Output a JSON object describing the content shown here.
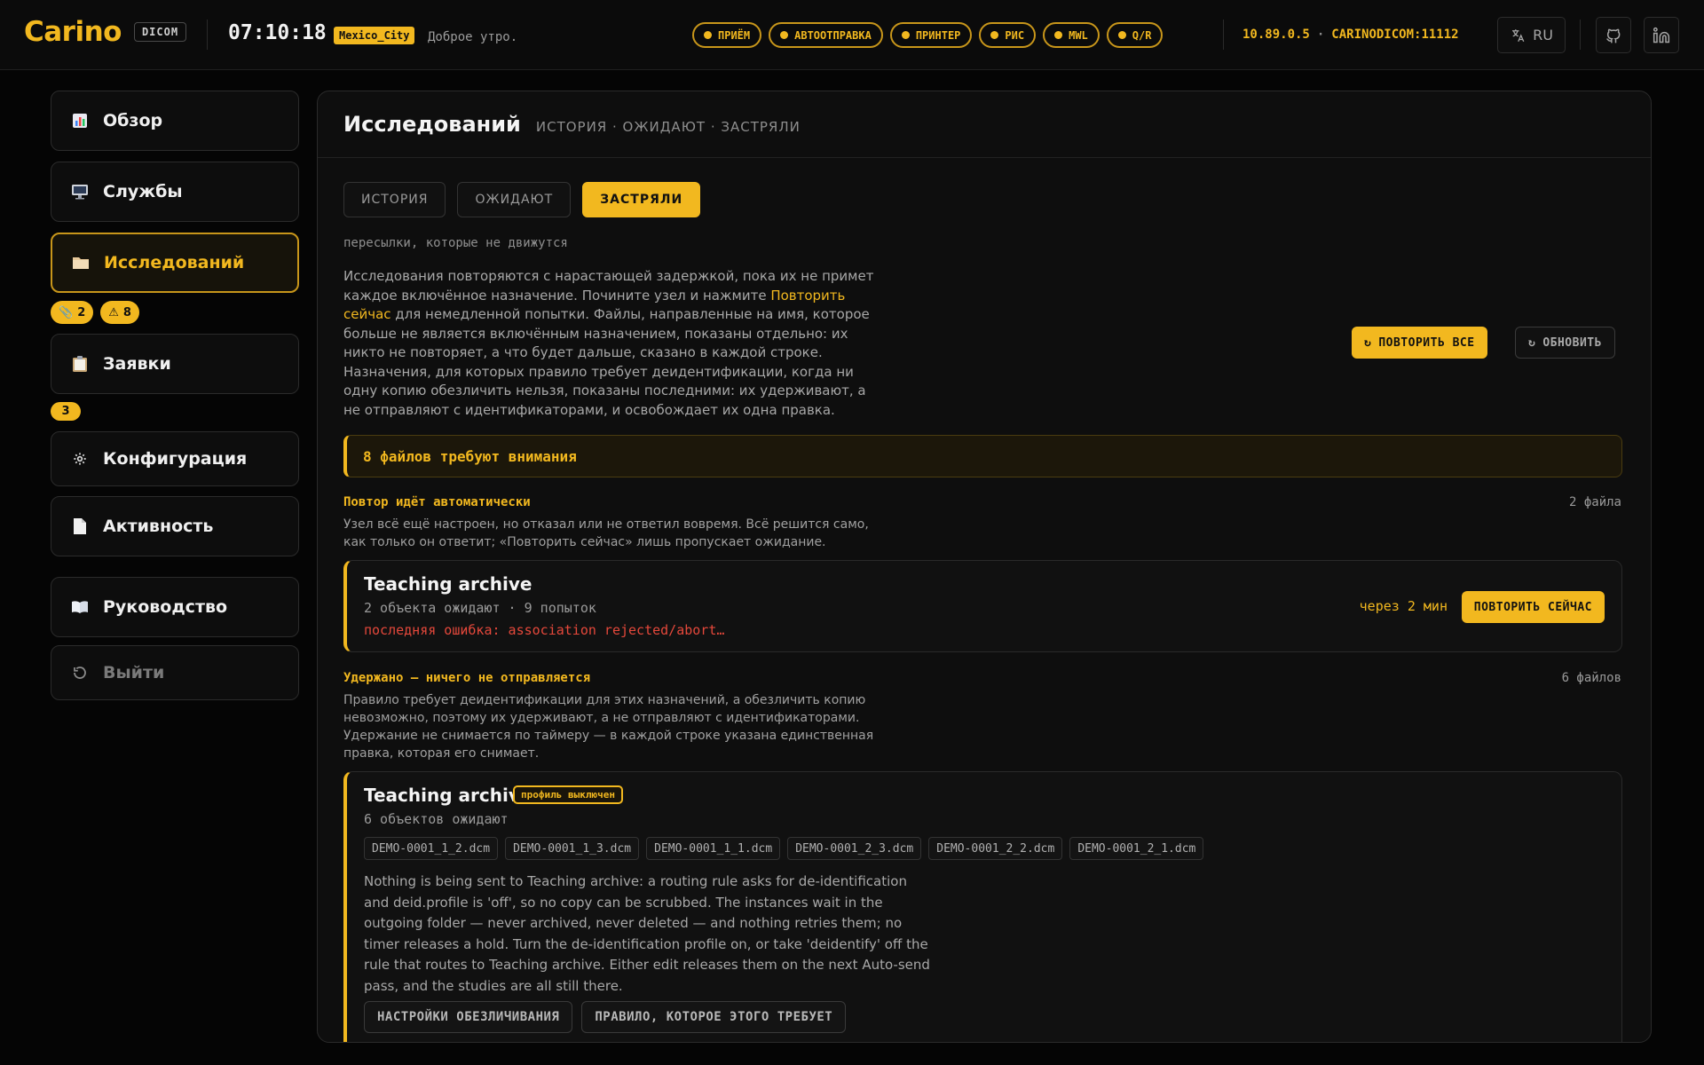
{
  "header": {
    "brand": "Carino",
    "brand_tag": "DICOM",
    "clock": "07:10:18",
    "timezone": "Mexico_City",
    "greeting": "Доброе утро.",
    "services": [
      {
        "label": "ПРИЁМ",
        "icon": "status-dot"
      },
      {
        "label": "АВТООТПРАВКА",
        "icon": "status-dot"
      },
      {
        "label": "ПРИНТЕР",
        "icon": "status-dot"
      },
      {
        "label": "РИС",
        "icon": "status-dot"
      },
      {
        "label": "MWL",
        "icon": "status-dot"
      },
      {
        "label": "Q/R",
        "icon": "status-dot"
      }
    ],
    "ip": "10.89.0.5",
    "ae_port": "CARINODICOM:11112",
    "lang": "RU",
    "accent": "#f2b81f"
  },
  "sidebar": {
    "items": [
      {
        "label": "Обзор",
        "icon": "chart-icon"
      },
      {
        "label": "Службы",
        "icon": "monitor-icon"
      },
      {
        "label": "Исследований",
        "icon": "folder-icon"
      },
      {
        "label": "Заявки",
        "icon": "clipboard-icon"
      },
      {
        "label": "Конфигурация",
        "icon": "gear-icon"
      },
      {
        "label": "Активность",
        "icon": "document-icon"
      },
      {
        "label": "Руководство",
        "icon": "book-icon"
      },
      {
        "label": "Выйти",
        "icon": "logout-icon"
      }
    ],
    "studies_badges": {
      "pending": "2",
      "stuck": "8"
    },
    "orders_badge": "3"
  },
  "main": {
    "title": "Исследований",
    "subtitle": "ИСТОРИЯ · ОЖИДАЮТ · ЗАСТРЯЛИ",
    "tabs": [
      "ИСТОРИЯ",
      "ОЖИДАЮТ",
      "ЗАСТРЯЛИ"
    ],
    "active_tab": "ЗАСТРЯЛИ",
    "caption": "пересылки, которые не движутся",
    "intro_1": "Исследования повторяются с нарастающей задержкой, пока их не примет каждое включённое назначение. Почините узел и нажмите ",
    "intro_link": "Повторить сейчас",
    "intro_2": " для немедленной попытки. Файлы, направленные на имя, которое больше не является включённым назначением, показаны отдельно: их никто не повторяет, а что будет дальше, сказано в каждой строке. Назначения, для которых правило требует деидентификации, когда ни одну копию обезличить нельзя, показаны последними: их удерживают, а не отправляют с идентификаторами, и освобождает их одна правка.",
    "retry_all": "ПОВТОРИТЬ ВСЕ",
    "refresh": "ОБНОВИТЬ",
    "alert": "8 файлов требуют внимания",
    "section_auto": {
      "heading": "Повтор идёт автоматически",
      "count": "2 файла",
      "desc": "Узел всё ещё настроен, но отказал или не ответил вовремя. Всё решится само, как только он ответит; «Повторить сейчас» лишь пропускает ожидание.",
      "card": {
        "title": "Teaching archive",
        "meta": "2 объекта ожидают · 9 попыток",
        "error": "последняя ошибка: association rejected/abort…",
        "when": "через 2 мин",
        "retry_now": "ПОВТОРИТЬ СЕЙЧАС"
      }
    },
    "section_held": {
      "heading": "Удержано — ничего не отправляется",
      "count": "6 файлов",
      "desc": "Правило требует деидентификации для этих назначений, а обезличить копию невозможно, поэтому их удерживают, а не отправляют с идентификаторами. Удержание не снимается по таймеру — в каждой строке указана единственная правка, которая его снимает.",
      "card": {
        "title": "Teaching archive",
        "badge": "профиль выключен",
        "meta": "6 объектов ожидают",
        "files": [
          "DEMO-0001_1_2.dcm",
          "DEMO-0001_1_3.dcm",
          "DEMO-0001_1_1.dcm",
          "DEMO-0001_2_3.dcm",
          "DEMO-0001_2_2.dcm",
          "DEMO-0001_2_1.dcm"
        ],
        "text": "Nothing is being sent to Teaching archive: a routing rule asks for de-identification and deid.profile is 'off', so no copy can be scrubbed. The instances wait in the outgoing folder — never archived, never deleted — and nothing retries them; no timer releases a hold. Turn the de-identification profile on, or take 'deidentify' off the rule that routes to Teaching archive. Either edit releases them on the next Auto-send pass, and the studies are all still there.",
        "btn_deid": "НАСТРОЙКИ ОБЕЗЛИЧИВАНИЯ",
        "btn_rule": "ПРАВИЛО, КОТОРОЕ ЭТОГО ТРЕБУЕТ"
      }
    }
  }
}
